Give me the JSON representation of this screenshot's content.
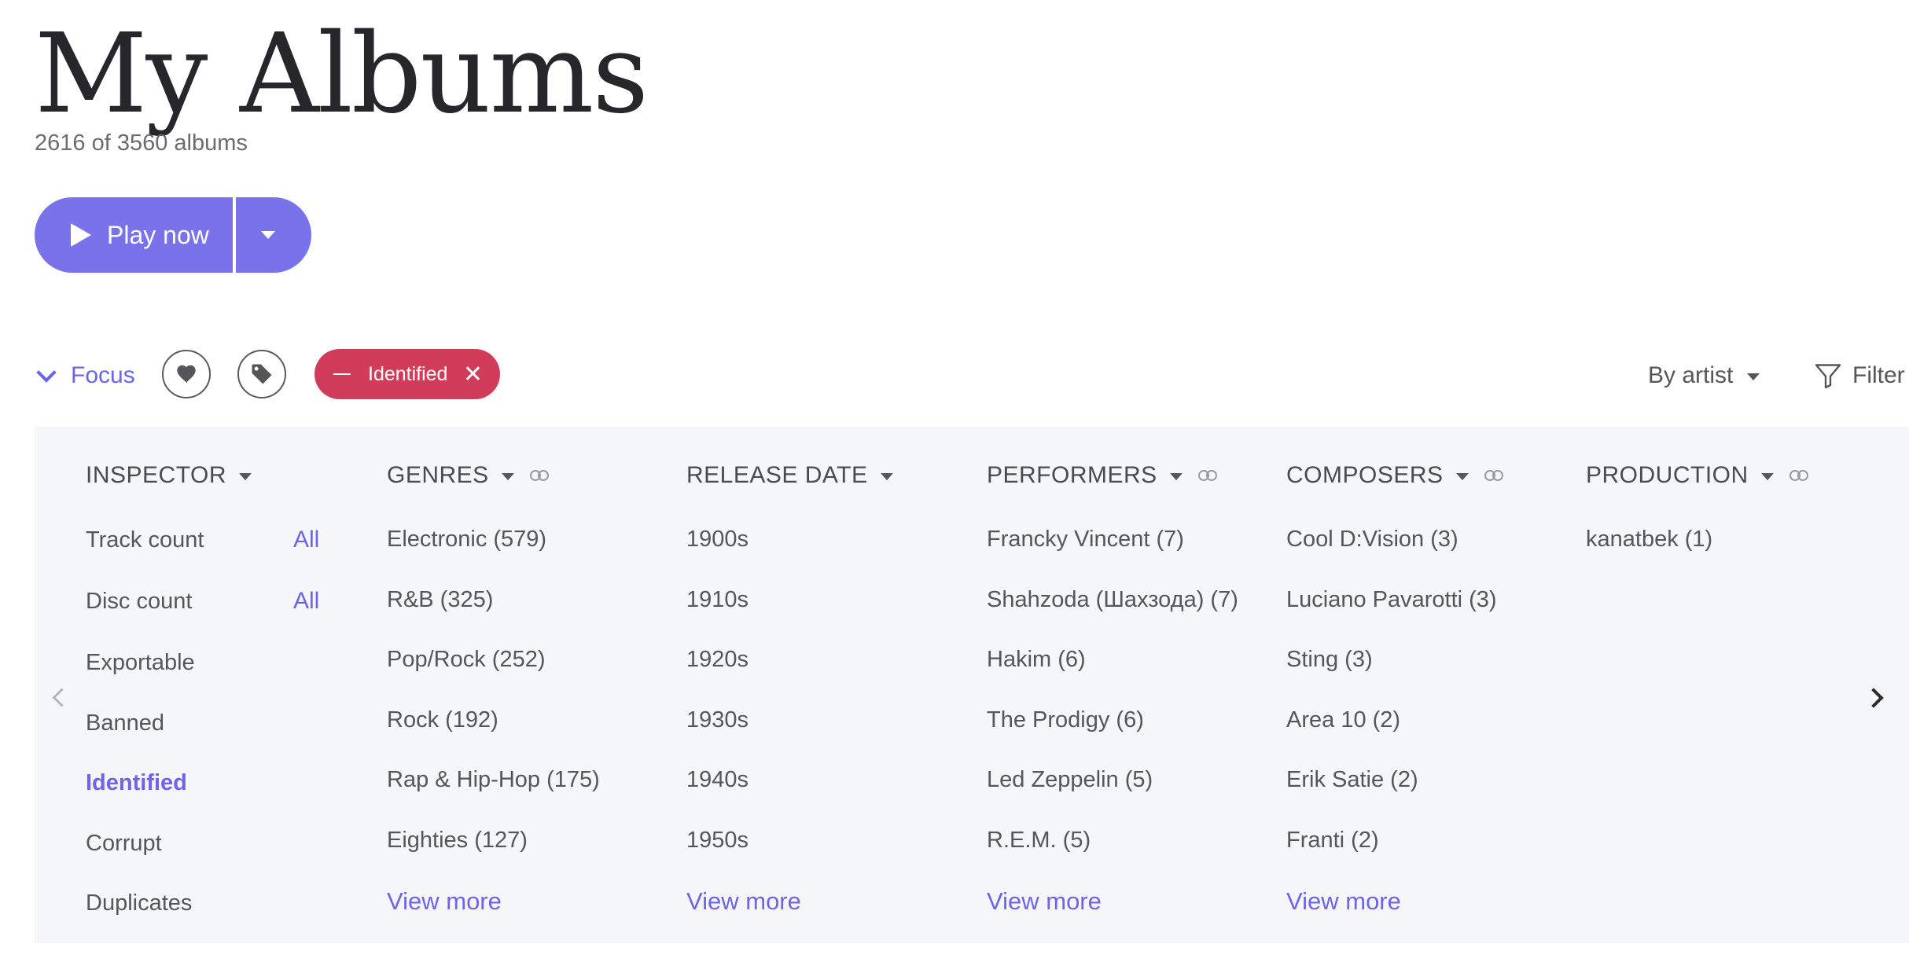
{
  "header": {
    "title": "My Albums",
    "subtitle": "2616 of 3560 albums"
  },
  "play": {
    "label": "Play now",
    "color": "#7a72eb"
  },
  "toolbar": {
    "focus_label": "Focus",
    "chip_label": "Identified",
    "chip_color": "#d13c5a",
    "sort_label": "By artist",
    "filter_label": "Filter"
  },
  "inspector": {
    "title": "INSPECTOR",
    "items": [
      {
        "label": "Track count",
        "value": "All"
      },
      {
        "label": "Disc count",
        "value": "All"
      },
      {
        "label": "Exportable"
      },
      {
        "label": "Banned"
      },
      {
        "label": "Identified",
        "active": true
      },
      {
        "label": "Corrupt"
      },
      {
        "label": "Duplicates"
      }
    ]
  },
  "columns": [
    {
      "title": "GENRES",
      "items": [
        "Electronic (579)",
        "R&B (325)",
        "Pop/Rock (252)",
        "Rock (192)",
        "Rap & Hip-Hop (175)",
        "Eighties (127)"
      ],
      "view_more": "View more"
    },
    {
      "title": "RELEASE DATE",
      "items": [
        "1900s",
        "1910s",
        "1920s",
        "1930s",
        "1940s",
        "1950s"
      ],
      "view_more": "View more"
    },
    {
      "title": "PERFORMERS",
      "items": [
        "Francky Vincent (7)",
        "Shahzoda (Шахзода) (7)",
        "Hakim (6)",
        "The Prodigy (6)",
        "Led Zeppelin (5)",
        "R.E.M. (5)"
      ],
      "view_more": "View more"
    },
    {
      "title": "COMPOSERS",
      "items": [
        "Cool D:Vision (3)",
        "Luciano Pavarotti (3)",
        "Sting (3)",
        "Area 10 (2)",
        "Erik Satie (2)",
        "Franti (2)"
      ],
      "view_more": "View more"
    },
    {
      "title": "PRODUCTION",
      "items": [
        "kanatbek (1)"
      ]
    }
  ],
  "icons": {
    "focus": "chevron-down-icon",
    "favorite": "heart-icon",
    "tag": "tag-icon",
    "chip_minus": "minus-icon",
    "chip_close": "close-icon",
    "sort": "caret-down-icon",
    "filter": "funnel-icon",
    "link": "link-rings-icon",
    "prev": "chevron-left-icon",
    "next": "chevron-right-icon"
  },
  "colors": {
    "accent": "#6d64e6",
    "panel_bg": "#f5f6fa",
    "text": "#55555a"
  }
}
